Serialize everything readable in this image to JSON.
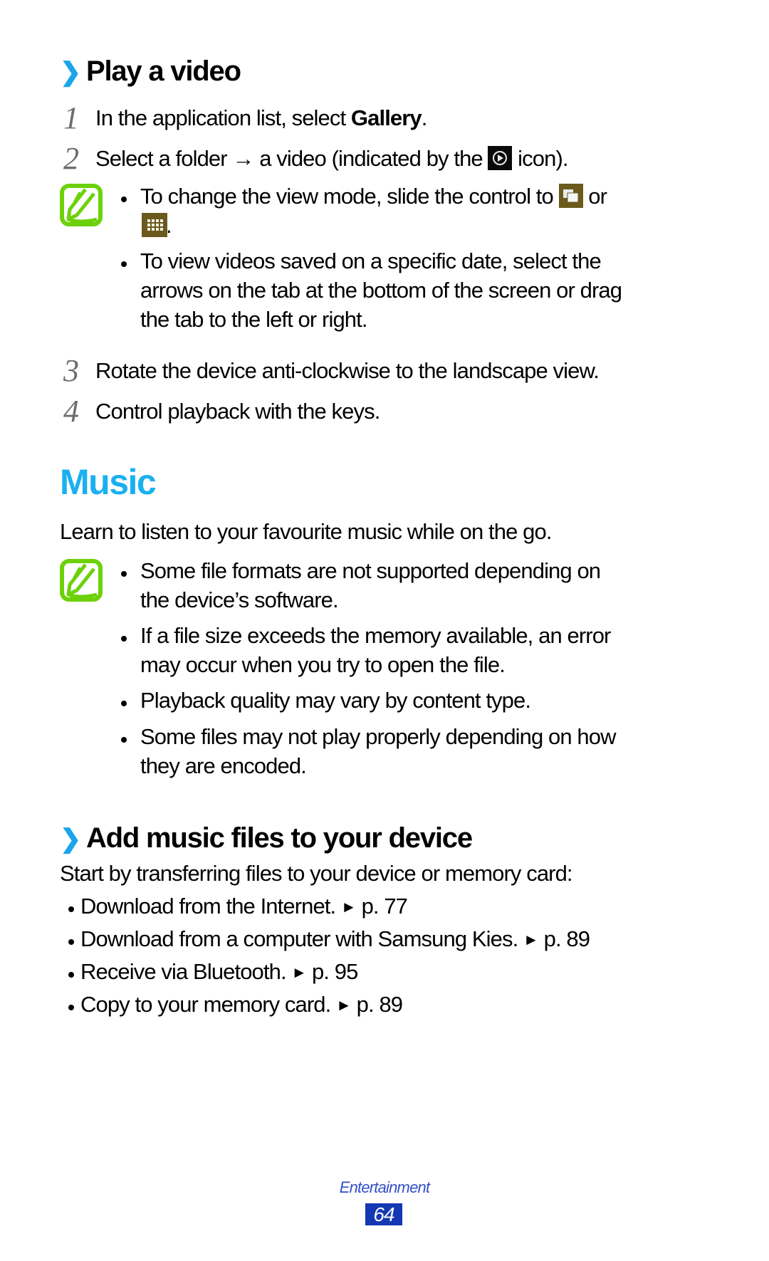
{
  "play_video": {
    "heading_chevron": "❯",
    "heading": "Play a video",
    "steps": [
      {
        "num": "1",
        "text_before": "In the application list, select ",
        "bold": "Gallery",
        "text_after": "."
      },
      {
        "num": "2",
        "text_before": "Select a folder → a video (indicated by the ",
        "icon": "video-play-icon",
        "text_after": " icon)."
      },
      {
        "num": "3",
        "text": "Rotate the device anti-clockwise to the landscape view."
      },
      {
        "num": "4",
        "text": "Control playback with the keys."
      }
    ],
    "notes": {
      "icon": "note-pencil-icon",
      "bullets": [
        {
          "line1_before": "To change the view mode, slide the control to ",
          "icon1": "stack-view-icon",
          "line1_after": " or",
          "icon2": "grid-view-icon",
          "line2_after": "."
        },
        {
          "lines": [
            "To view videos saved on a specific date, select the",
            "arrows on the tab at the bottom of the screen or drag",
            "the tab to the left or right."
          ]
        }
      ]
    }
  },
  "music": {
    "title": "Music",
    "intro": "Learn to listen to your favourite music while on the go.",
    "notes": {
      "icon": "note-pencil-icon",
      "bullets": [
        {
          "lines": [
            "Some file formats are not supported depending on",
            "the device’s software."
          ]
        },
        {
          "lines": [
            "If a file size exceeds the memory available, an error",
            "may occur when you try to open the file."
          ]
        },
        {
          "lines": [
            "Playback quality may vary by content type."
          ]
        },
        {
          "lines": [
            "Some files may not play properly depending on how",
            "they are encoded."
          ]
        }
      ]
    }
  },
  "add_music": {
    "heading_chevron": "❯",
    "heading": "Add music files to your device",
    "intro": "Start by transferring files to your device or memory card:",
    "items": [
      {
        "text": "Download from the Internet.",
        "arrow": "►",
        "ref": "p. 77"
      },
      {
        "text": "Download from a computer with Samsung Kies.",
        "arrow": "►",
        "ref": "p. 89"
      },
      {
        "text": "Receive via Bluetooth.",
        "arrow": "►",
        "ref": "p. 95"
      },
      {
        "text": "Copy to your memory card.",
        "arrow": "►",
        "ref": "p. 89"
      }
    ]
  },
  "footer": {
    "section": "Entertainment",
    "page": "64"
  },
  "colors": {
    "accent_blue": "#1ab0f0",
    "chevron_blue": "#1aa5ea",
    "note_green": "#6cd10a",
    "footer_blue": "#3550c8",
    "page_badge": "#1438b4",
    "icon_olive": "#6b5a1c"
  }
}
